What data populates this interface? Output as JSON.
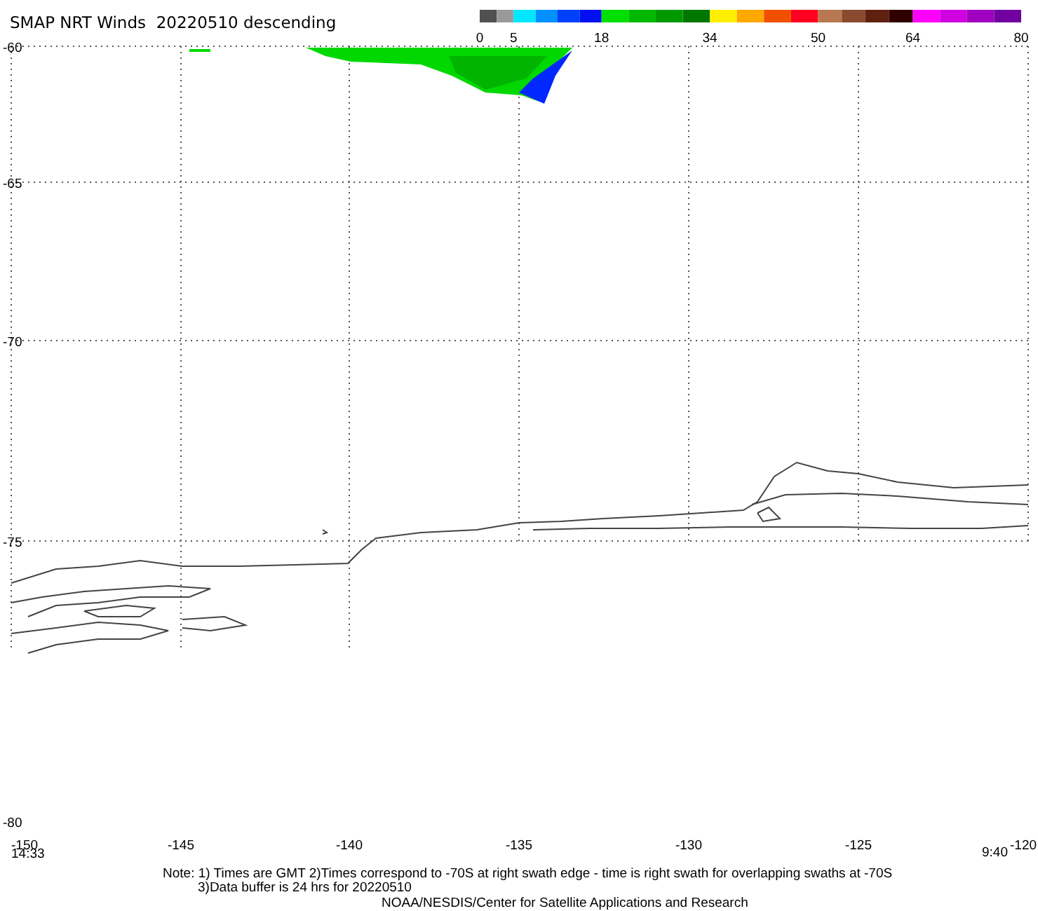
{
  "title": "SMAP NRT Winds  20220510 descending",
  "colorbar": {
    "ticks": [
      "0",
      "5",
      "18",
      "34",
      "50",
      "64",
      "80"
    ],
    "intervals": [
      {
        "swatches": [
          {
            "color": "#505050"
          },
          {
            "color": "#9a9a9a"
          }
        ]
      },
      {
        "swatches": [
          {
            "color": "#00e8ff"
          },
          {
            "color": "#0090ff"
          },
          {
            "color": "#0040ff"
          },
          {
            "color": "#0010f0"
          }
        ]
      },
      {
        "swatches": [
          {
            "color": "#00e000"
          },
          {
            "color": "#00b800"
          },
          {
            "color": "#009a00"
          },
          {
            "color": "#007800"
          }
        ]
      },
      {
        "swatches": [
          {
            "color": "#ffef00"
          },
          {
            "color": "#ffa800"
          },
          {
            "color": "#f05000"
          },
          {
            "color": "#ff0020"
          }
        ]
      },
      {
        "swatches": [
          {
            "color": "#b87850"
          },
          {
            "color": "#8a4a30"
          },
          {
            "color": "#602010"
          },
          {
            "color": "#300000"
          }
        ]
      },
      {
        "swatches": [
          {
            "color": "#ff00ff"
          },
          {
            "color": "#d000e0"
          },
          {
            "color": "#a000c0"
          },
          {
            "color": "#7000a0"
          }
        ]
      }
    ]
  },
  "map": {
    "lat_labels": [
      "-60",
      "-65",
      "-70",
      "-75",
      "-80"
    ],
    "lon_labels": [
      "-150",
      "-145",
      "-140",
      "-135",
      "-130",
      "-125",
      "-120"
    ],
    "start_time": "14:33",
    "end_time": "9:40"
  },
  "notes": [
    "Note: 1) Times are GMT 2)Times correspond to -70S at right swath edge - time is right swath for overlapping swaths at -70S",
    "3)Data buffer is 24 hrs for 20220510"
  ],
  "credit": "NOAA/NESDIS/Center for Satellite Applications and Research"
}
